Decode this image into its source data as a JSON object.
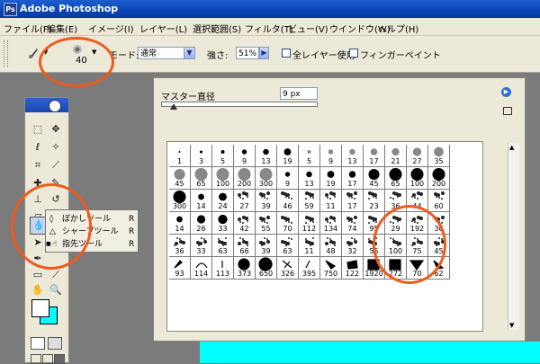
{
  "window": {
    "title": "Adobe Photoshop"
  },
  "menu": [
    "ファイル(F)",
    "編集(E)",
    "イメージ(I)",
    "レイヤー(L)",
    "選択範囲(S)",
    "フィルタ(T)",
    "ビュー(V)",
    "ウインドウ(W)",
    "ヘルプ(H)"
  ],
  "options": {
    "brush_size": "40",
    "mode_label": "モード:",
    "mode_value": "通常",
    "strength_label": "強さ:",
    "strength_value": "51%",
    "all_layers_label": "全レイヤー使用",
    "finger_paint_label": "フィンガーペイント"
  },
  "flyout": {
    "items": [
      {
        "label": "ぼかしツール",
        "shortcut": "R"
      },
      {
        "label": "シャープツール",
        "shortcut": "R"
      },
      {
        "label": "指先ツール",
        "shortcut": "R"
      }
    ]
  },
  "brush_panel": {
    "master_label": "マスター直径",
    "master_value": "9 px",
    "brushes": [
      "1",
      "3",
      "5",
      "9",
      "13",
      "19",
      "5",
      "9",
      "13",
      "17",
      "21",
      "27",
      "35",
      "45",
      "65",
      "100",
      "200",
      "300",
      "9",
      "13",
      "19",
      "17",
      "45",
      "65",
      "100",
      "200",
      "300",
      "14",
      "24",
      "27",
      "39",
      "46",
      "59",
      "11",
      "17",
      "23",
      "36",
      "44",
      "60",
      "14",
      "26",
      "33",
      "42",
      "55",
      "70",
      "112",
      "134",
      "74",
      "95",
      "29",
      "192",
      "36",
      "36",
      "33",
      "63",
      "66",
      "39",
      "63",
      "11",
      "48",
      "32",
      "55",
      "100",
      "75",
      "45",
      "93",
      "114",
      "113",
      "373",
      "650",
      "326",
      "395",
      "750",
      "122",
      "1920",
      "272",
      "70",
      "62"
    ]
  }
}
